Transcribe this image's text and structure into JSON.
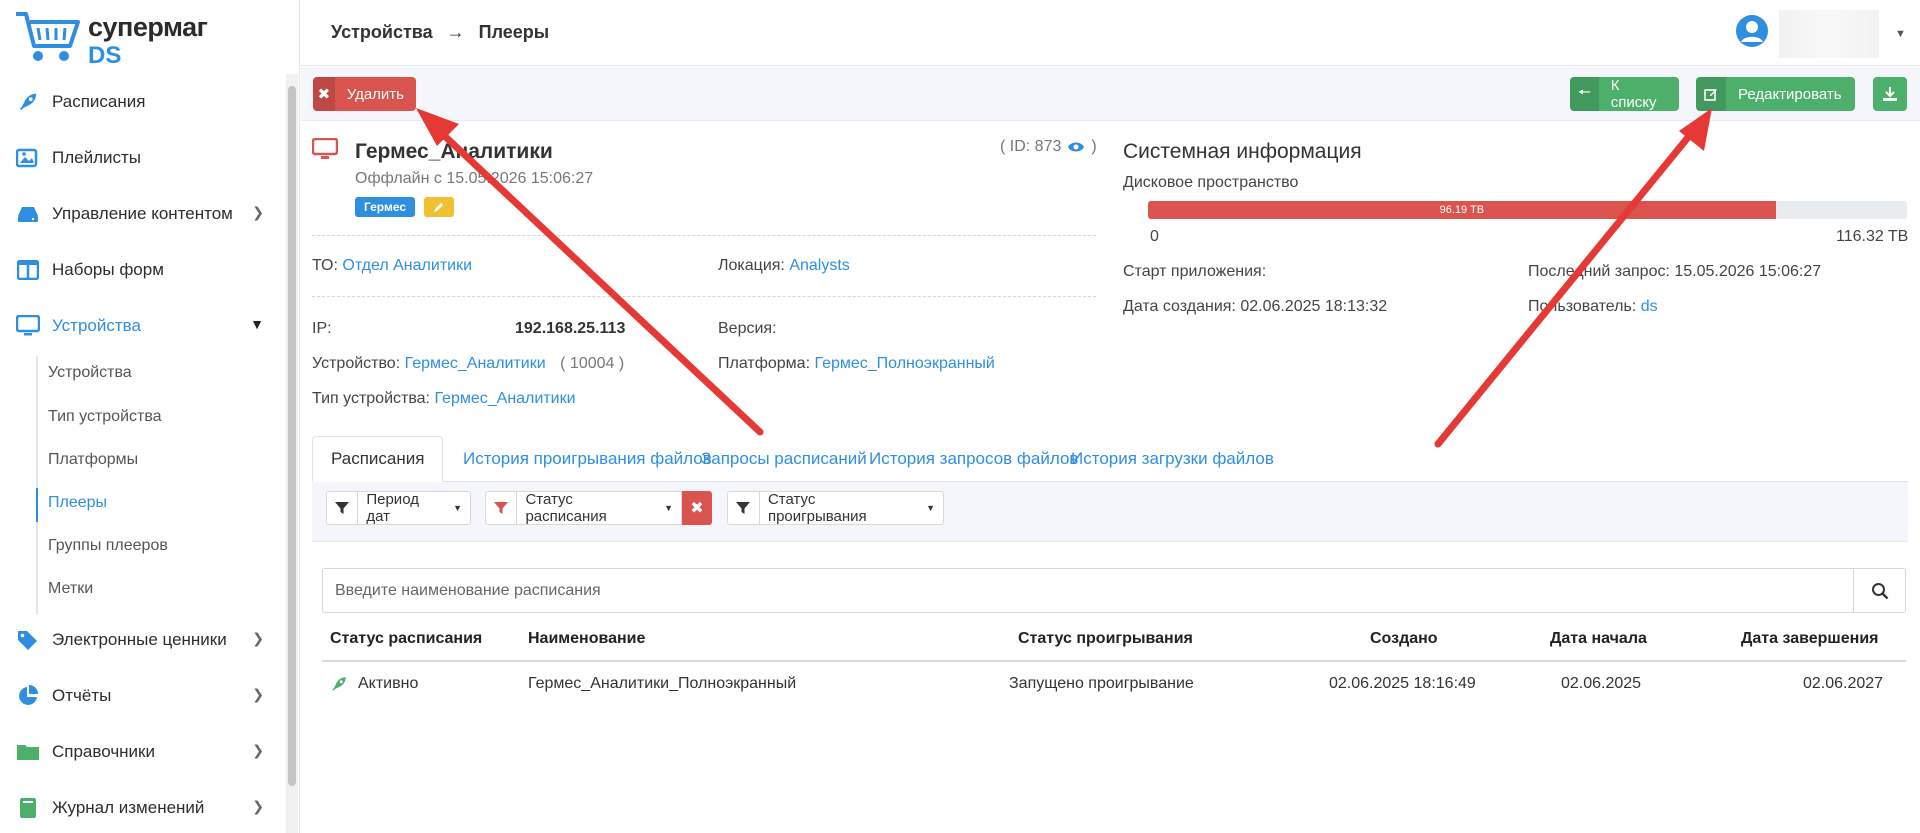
{
  "app": {
    "logo_line1": "супермаг",
    "logo_line2": "DS"
  },
  "sidebar": {
    "items": [
      {
        "label": "Расписания"
      },
      {
        "label": "Плейлисты"
      },
      {
        "label": "Управление контентом"
      },
      {
        "label": "Наборы форм"
      },
      {
        "label": "Устройства"
      },
      {
        "label": "Электронные ценники"
      },
      {
        "label": "Отчёты"
      },
      {
        "label": "Справочники"
      },
      {
        "label": "Журнал изменений"
      }
    ],
    "subitems": [
      {
        "label": "Устройства"
      },
      {
        "label": "Тип устройства"
      },
      {
        "label": "Платформы"
      },
      {
        "label": "Плееры"
      },
      {
        "label": "Группы плееров"
      },
      {
        "label": "Метки"
      }
    ]
  },
  "header": {
    "crumb1": "Устройства",
    "crumb_sep": "→",
    "crumb2": "Плееры"
  },
  "toolbar": {
    "delete_label": "Удалить",
    "list_label": "К списку",
    "edit_label": "Редактировать"
  },
  "device": {
    "name": "Гермес_Аналитики",
    "id_text": "( ID: 873",
    "id_close": ")",
    "status": "Оффлайн с 15.05.2026 15:06:27",
    "tag": "Гермес",
    "to_label": "ТО:",
    "to_value": "Отдел Аналитики",
    "location_label": "Локация:",
    "location_value": "Analysts",
    "ip_label": "IP:",
    "ip_value": "192.168.25.113",
    "version_label": "Версия:",
    "device_label": "Устройство:",
    "device_value": "Гермес_Аналитики",
    "device_code": "( 10004 )",
    "platform_label": "Платформа:",
    "platform_value": "Гермес_Полноэкранный",
    "type_label": "Тип устройства:",
    "type_value": "Гермес_Аналитики"
  },
  "system": {
    "title": "Системная информация",
    "disk_label": "Дисковое пространство",
    "disk_used": "96.19 TB",
    "disk_used_fraction": 0.827,
    "disk_min": "0",
    "disk_max": "116.32 TB",
    "start_label": "Старт приложения:",
    "last_request": "Последний запрос: 15.05.2026 15:06:27",
    "created": "Дата создания: 02.06.2025 18:13:32",
    "user_label": "Пользователь:",
    "user_value": "ds"
  },
  "tabs": [
    {
      "label": "Расписания"
    },
    {
      "label": "История проигрывания файлов"
    },
    {
      "label": "Запросы расписаний"
    },
    {
      "label": "История запросов файлов"
    },
    {
      "label": "История загрузки файлов"
    }
  ],
  "filters": {
    "period": "Период дат",
    "schedule_status": "Статус расписания",
    "play_status": "Статус проигрывания"
  },
  "search": {
    "placeholder": "Введите наименование расписания"
  },
  "table": {
    "headers": [
      "Статус расписания",
      "Наименование",
      "Статус проигрывания",
      "Создано",
      "Дата начала",
      "Дата завершения"
    ],
    "rows": [
      {
        "status": "Активно",
        "name": "Гермес_Аналитики_Полноэкранный",
        "play_status": "Запущено проигрывание",
        "created": "02.06.2025 18:16:49",
        "start": "02.06.2025",
        "end": "02.06.2027"
      }
    ]
  },
  "colors": {
    "accent": "#2e8fe0",
    "danger": "#d9534f",
    "success": "#4caf6a",
    "arrow": "#e53935"
  }
}
